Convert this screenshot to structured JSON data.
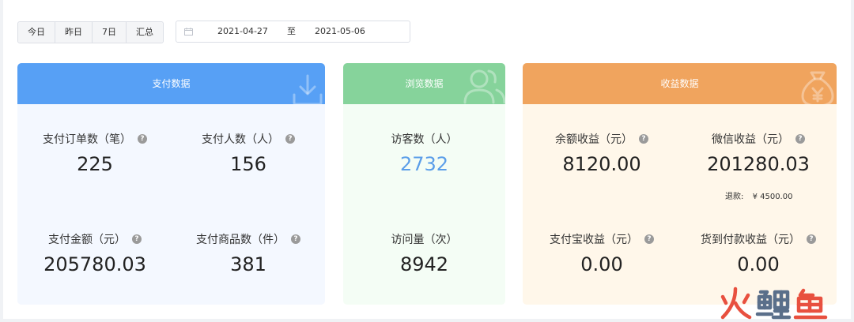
{
  "toolbar": {
    "ranges": [
      "今日",
      "昨日",
      "7日",
      "汇总"
    ],
    "date_start": "2021-04-27",
    "date_separator": "至",
    "date_end": "2021-05-06"
  },
  "pay": {
    "title": "支付数据",
    "icon": "download-icon",
    "color": "#57a0f5",
    "metrics": [
      {
        "label": "支付订单数（笔）",
        "value": "225"
      },
      {
        "label": "支付人数（人）",
        "value": "156"
      },
      {
        "label": "支付金额（元）",
        "value": "205780.03"
      },
      {
        "label": "支付商品数（件）",
        "value": "381"
      }
    ]
  },
  "view": {
    "title": "浏览数据",
    "icon": "users-icon",
    "color": "#86d39b",
    "metrics": [
      {
        "label": "访客数（人）",
        "value": "2732"
      },
      {
        "label": "访问量（次）",
        "value": "8942"
      }
    ]
  },
  "income": {
    "title": "收益数据",
    "icon": "money-bag-icon",
    "color": "#f0a45e",
    "metrics": [
      {
        "label": "余额收益（元）",
        "value": "8120.00"
      },
      {
        "label": "微信收益（元）",
        "value": "201280.03"
      },
      {
        "label": "支付宝收益（元）",
        "value": "0.00"
      },
      {
        "label": "货到付款收益（元）",
        "value": "0.00"
      }
    ],
    "refund_label": "退款:",
    "refund_value": "¥ 4500.00"
  },
  "watermark": {
    "text": "火鲤鱼"
  }
}
